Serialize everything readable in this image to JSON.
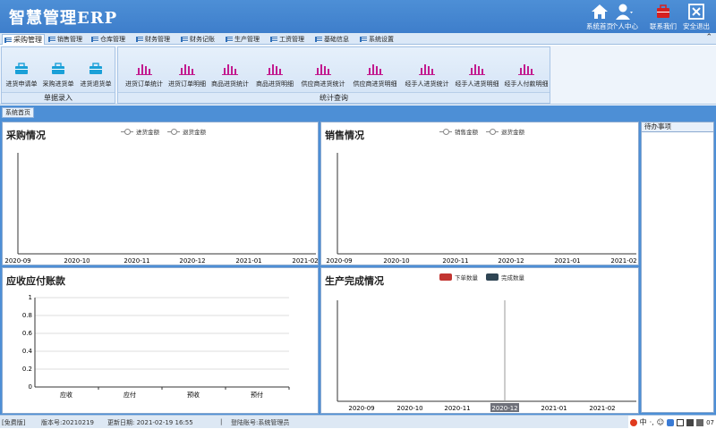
{
  "app": {
    "title": "智慧管理ERP"
  },
  "topnav": [
    {
      "label": "系统首页",
      "icon": "home-icon"
    },
    {
      "label": "个人中心",
      "icon": "user-icon"
    },
    {
      "label": "联系我们",
      "icon": "briefcase-icon"
    },
    {
      "label": "安全退出",
      "icon": "exit-icon"
    }
  ],
  "tabs": [
    {
      "label": "采购管理",
      "active": true
    },
    {
      "label": "销售管理"
    },
    {
      "label": "仓库管理"
    },
    {
      "label": "财务管理"
    },
    {
      "label": "财务记账"
    },
    {
      "label": "生产管理"
    },
    {
      "label": "工资管理"
    },
    {
      "label": "基础信息"
    },
    {
      "label": "系统设置"
    }
  ],
  "ribbon": {
    "group1": {
      "label": "单据录入",
      "buttons": [
        "进货申请单",
        "采购进货单",
        "进货退货单"
      ],
      "icon": "briefcase-icon"
    },
    "group2": {
      "label": "统计查询",
      "buttons": [
        "进货订单统计",
        "进货订单明细",
        "商品进货统计",
        "商品进货明细",
        "供应商进货统计",
        "供应商进货明细",
        "经手人进货统计",
        "经手人进货明细",
        "经手人付款明细"
      ],
      "icon": "bar-chart-icon"
    }
  },
  "home_tab": "系统首页",
  "panels": {
    "purchase": {
      "title": "采购情况",
      "legend": [
        "进货金额",
        "退货金额"
      ]
    },
    "sales": {
      "title": "销售情况",
      "legend": [
        "销售金额",
        "退货金额"
      ]
    },
    "accounts": {
      "title": "应收应付账款"
    },
    "production": {
      "title": "生产完成情况",
      "legend": [
        "下单数量",
        "完成数量"
      ]
    },
    "todo": {
      "title": "待办事项"
    }
  },
  "chart_data": [
    {
      "type": "line",
      "title": "采购情况",
      "x": [
        "2020-09",
        "2020-10",
        "2020-11",
        "2020-12",
        "2021-01",
        "2021-02"
      ],
      "series": [
        {
          "name": "进货金额",
          "values": []
        },
        {
          "name": "退货金额",
          "values": []
        }
      ]
    },
    {
      "type": "line",
      "title": "销售情况",
      "x": [
        "2020-09",
        "2020-10",
        "2020-11",
        "2020-12",
        "2021-01",
        "2021-02"
      ],
      "series": [
        {
          "name": "销售金额",
          "values": []
        },
        {
          "name": "退货金额",
          "values": []
        }
      ]
    },
    {
      "type": "bar",
      "title": "应收应付账款",
      "categories": [
        "应收",
        "应付",
        "预收",
        "预付"
      ],
      "values": [
        0,
        0,
        0,
        0
      ],
      "yticks": [
        "0",
        "0.2",
        "0.4",
        "0.6",
        "0.8",
        "1"
      ],
      "ylim": [
        0,
        1
      ]
    },
    {
      "type": "bar",
      "title": "生产完成情况",
      "categories": [
        "2020-09",
        "2020-10",
        "2020-11",
        "2020-12",
        "2021-01",
        "2021-02"
      ],
      "series": [
        {
          "name": "下单数量",
          "values": []
        },
        {
          "name": "完成数量",
          "values": []
        }
      ],
      "highlighted_category": "2020-12"
    }
  ],
  "colors": {
    "accent": "#4d8fd6",
    "ribbon_icon": "#c21b8f",
    "briefcase": "#1aa0d8",
    "order_qty": "#c23531",
    "done_qty": "#2f4554"
  },
  "status": {
    "edition": "[免费版]",
    "version": "版本号:20210219",
    "update": "更新日期: 2021-02-19 16:55",
    "sep": "|",
    "login": "登陆账号:系统管理员",
    "tray_end": "07"
  }
}
